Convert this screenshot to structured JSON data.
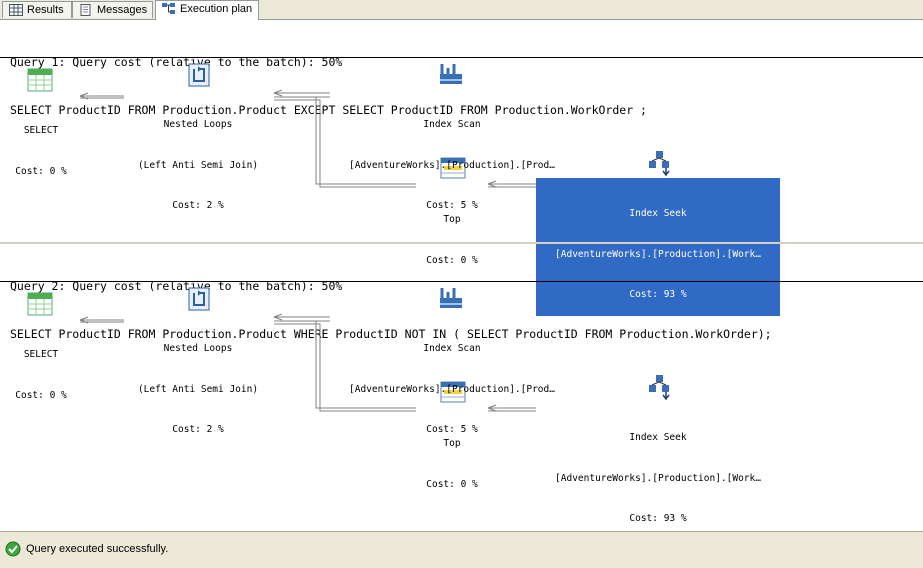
{
  "tabs": [
    {
      "label": "Results",
      "icon": "grid-icon"
    },
    {
      "label": "Messages",
      "icon": "document-icon"
    },
    {
      "label": "Execution plan",
      "icon": "plan-icon"
    }
  ],
  "queries": [
    {
      "cost_line": "Query 1: Query cost (relative to the batch): 50%",
      "sql": "SELECT ProductID FROM Production.Product EXCEPT SELECT ProductID FROM Production.WorkOrder ;",
      "ops": {
        "select": {
          "name": "SELECT",
          "cost": "Cost: 0 %"
        },
        "loops": {
          "name": "Nested Loops",
          "detail": "(Left Anti Semi Join)",
          "cost": "Cost: 2 %"
        },
        "scan": {
          "name": "Index Scan",
          "detail": "[AdventureWorks].[Production].[Prod…",
          "cost": "Cost: 5 %"
        },
        "top": {
          "name": "Top",
          "cost": "Cost: 0 %"
        },
        "seek": {
          "name": "Index Seek",
          "detail": "[AdventureWorks].[Production].[Work…",
          "cost": "Cost: 93 %"
        }
      }
    },
    {
      "cost_line": "Query 2: Query cost (relative to the batch): 50%",
      "sql": "SELECT ProductID FROM Production.Product WHERE ProductID NOT IN ( SELECT ProductID FROM Production.WorkOrder);",
      "ops": {
        "select": {
          "name": "SELECT",
          "cost": "Cost: 0 %"
        },
        "loops": {
          "name": "Nested Loops",
          "detail": "(Left Anti Semi Join)",
          "cost": "Cost: 2 %"
        },
        "scan": {
          "name": "Index Scan",
          "detail": "[AdventureWorks].[Production].[Prod…",
          "cost": "Cost: 5 %"
        },
        "top": {
          "name": "Top",
          "cost": "Cost: 0 %"
        },
        "seek": {
          "name": "Index Seek",
          "detail": "[AdventureWorks].[Production].[Work…",
          "cost": "Cost: 93 %"
        }
      }
    }
  ],
  "status": {
    "message": "Query executed successfully.",
    "icon": "check-circle-icon"
  },
  "colors": {
    "selection": "#316ac5",
    "edge": "#808080",
    "chrome": "#ece9d8"
  }
}
